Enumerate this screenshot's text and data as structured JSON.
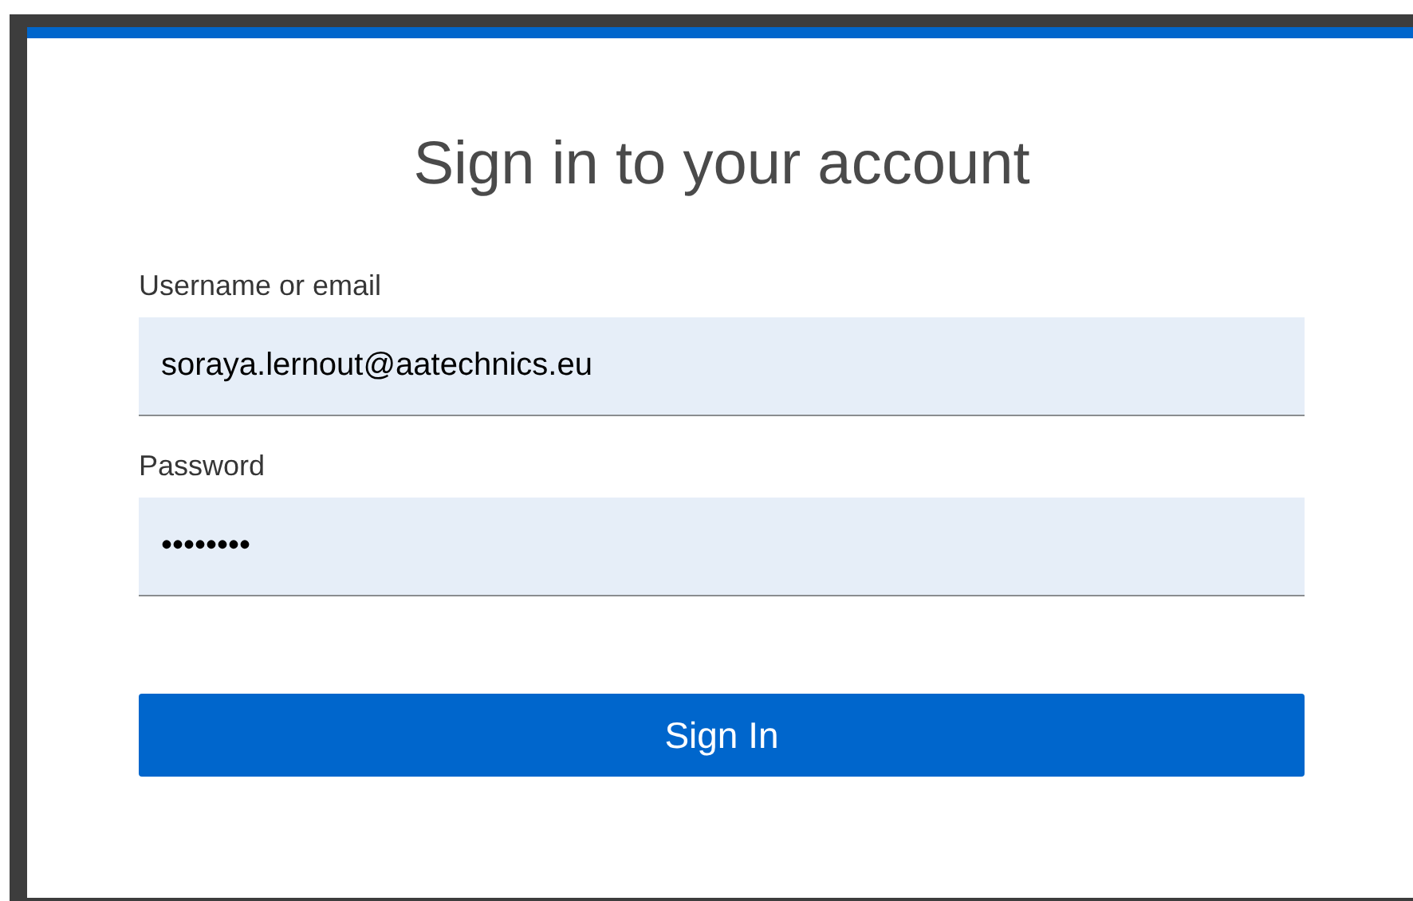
{
  "title": "Sign in to your account",
  "fields": [
    {
      "label": "Username or email",
      "value": "soraya.lernout@aatechnics.eu"
    },
    {
      "label": "Password",
      "value": "••••••••"
    }
  ],
  "submit_button": "Sign In"
}
